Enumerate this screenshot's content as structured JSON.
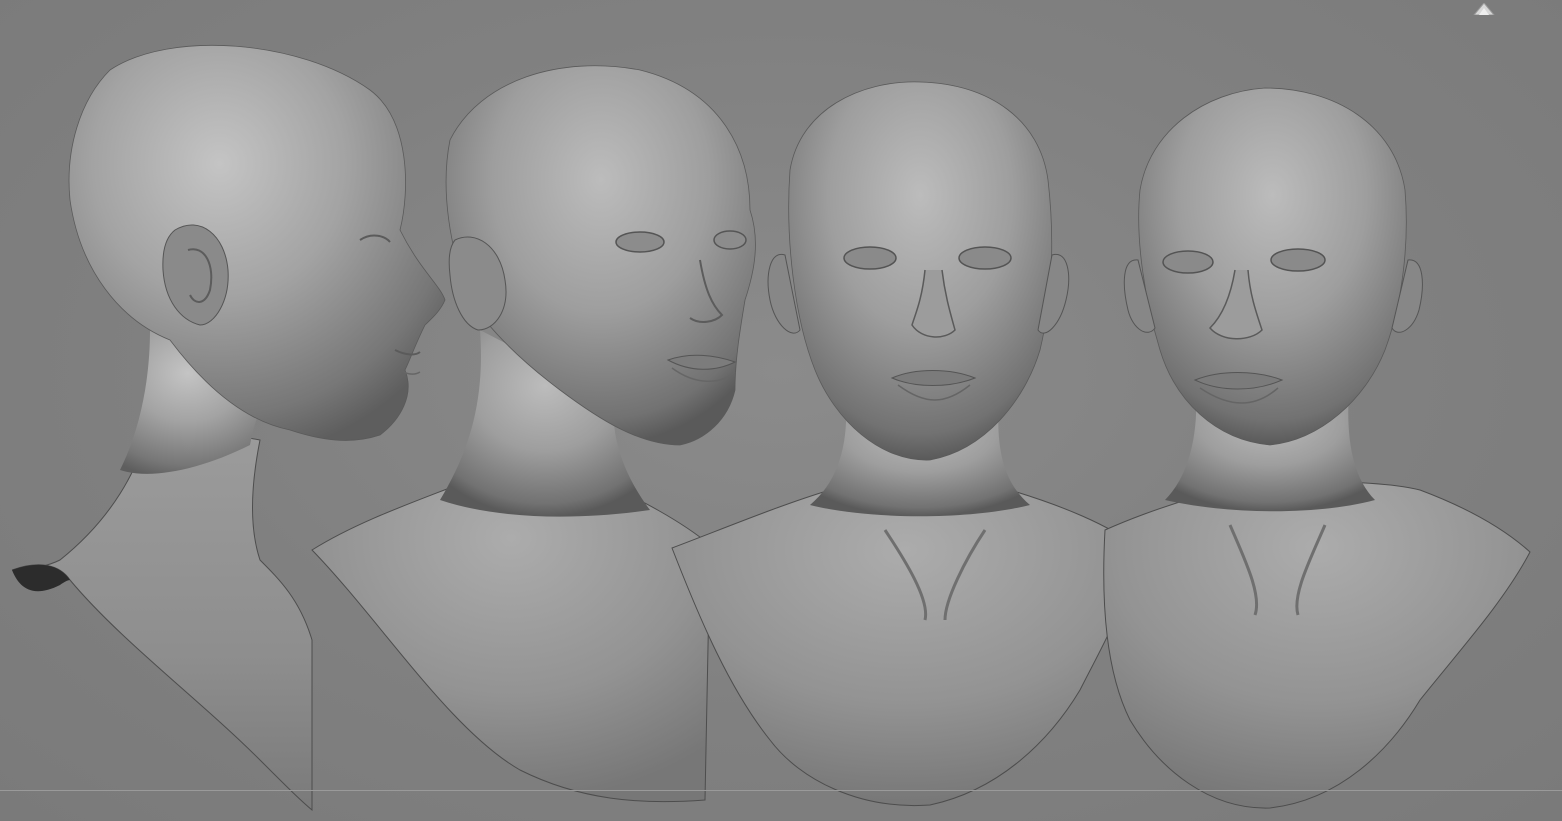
{
  "viewport": {
    "background_color": "#808080",
    "material_color": "#9a9a9a"
  },
  "models": [
    {
      "view": "side-profile"
    },
    {
      "view": "three-quarter"
    },
    {
      "view": "front"
    },
    {
      "view": "front-tilted"
    }
  ],
  "corner_widget": {
    "icon": "navigation-cube-icon"
  }
}
